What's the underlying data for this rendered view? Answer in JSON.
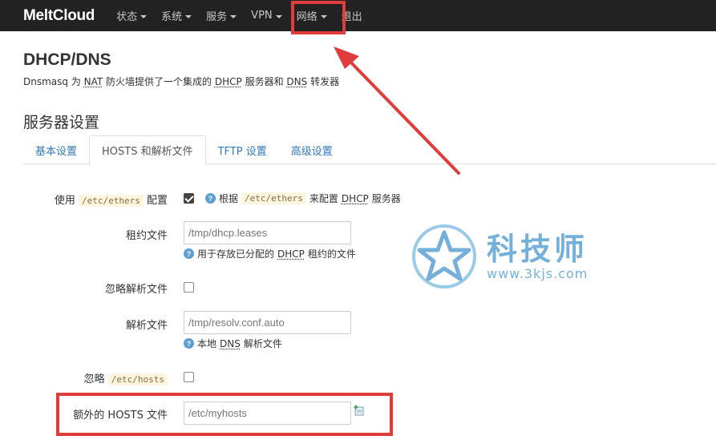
{
  "navbar": {
    "brand": "MeltCloud",
    "items": [
      {
        "label": "状态",
        "dropdown": true
      },
      {
        "label": "系统",
        "dropdown": true
      },
      {
        "label": "服务",
        "dropdown": true
      },
      {
        "label": "VPN",
        "dropdown": true
      },
      {
        "label": "网络",
        "dropdown": true
      },
      {
        "label": "退出",
        "dropdown": false
      }
    ]
  },
  "header": {
    "title": "DHCP/DNS",
    "desc_prefix": "Dnsmasq 为 ",
    "desc_nat": "NAT",
    "desc_mid": " 防火墙提供了一个集成的 ",
    "desc_dhcp": "DHCP",
    "desc_mid2": " 服务器和 ",
    "desc_dns": "DNS",
    "desc_suffix": " 转发器"
  },
  "section": {
    "title": "服务器设置"
  },
  "tabs": [
    {
      "label": "基本设置",
      "active": false
    },
    {
      "label": "HOSTS 和解析文件",
      "active": true
    },
    {
      "label": "TFTP 设置",
      "active": false
    },
    {
      "label": "高级设置",
      "active": false
    }
  ],
  "form": {
    "use_ethers": {
      "label_prefix": "使用 ",
      "label_code": "/etc/ethers",
      "label_suffix": " 配置",
      "checked": true,
      "help_prefix": "根据 ",
      "help_code": "/etc/ethers",
      "help_mid": " 来配置 ",
      "help_dhcp": "DHCP",
      "help_suffix": " 服务器"
    },
    "lease_file": {
      "label": "租约文件",
      "placeholder": "/tmp/dhcp.leases",
      "help_prefix": "用于存放已分配的 ",
      "help_dhcp": "DHCP",
      "help_suffix": " 租约的文件"
    },
    "ignore_resolv": {
      "label": "忽略解析文件",
      "checked": false
    },
    "resolv_file": {
      "label": "解析文件",
      "placeholder": "/tmp/resolv.conf.auto",
      "help_prefix": "本地 ",
      "help_dns": "DNS",
      "help_suffix": " 解析文件"
    },
    "ignore_hosts": {
      "label_prefix": "忽略 ",
      "label_code": "/etc/hosts",
      "checked": false
    },
    "extra_hosts": {
      "label": "额外的 HOSTS 文件",
      "placeholder": "/etc/myhosts"
    }
  },
  "watermark": {
    "text": "科技师",
    "url": "www.3kjs.com"
  },
  "colors": {
    "navbar": "#222222",
    "accent": "#337ab7",
    "annotation": "#e03c3c",
    "watermark": "#3a8fcb"
  }
}
